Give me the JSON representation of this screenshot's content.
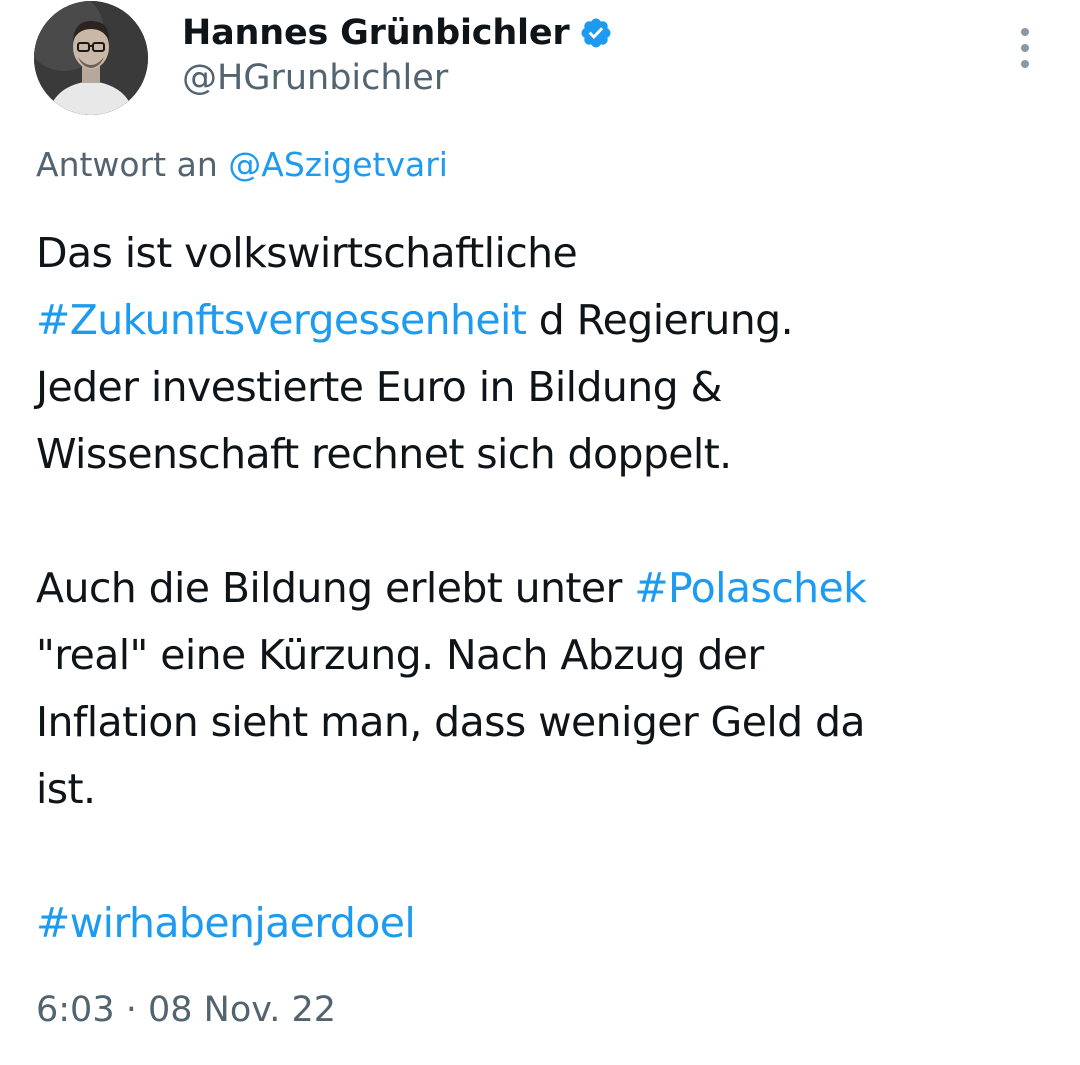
{
  "author": {
    "display_name": "Hannes Grünbichler",
    "handle": "@HGrunbichler",
    "verified_icon": "verified-badge-icon"
  },
  "reply": {
    "prefix": "Antwort an",
    "mention": "@ASzigetvari"
  },
  "tweet": {
    "line1": "Das ist volkswirtschaftliche",
    "line2_hashtag": "#Zukunftsvergessenheit",
    "line2_rest": " d Regierung.",
    "line3": "Jeder investierte Euro in Bildung &",
    "line4": "Wissenschaft rechnet sich doppelt.",
    "line6_text": "Auch die Bildung erlebt unter ",
    "line6_hashtag": "#Polaschek",
    "line7": "\"real\" eine Kürzung. Nach Abzug der",
    "line8": "Inflation sieht man, dass weniger Geld da",
    "line9": "ist.",
    "line11_hashtag": "#wirhabenjaerdoel"
  },
  "meta": {
    "timestamp": "6:03 · 08 Nov. 22"
  },
  "colors": {
    "link": "#1d9bf0",
    "secondary_text": "#536471",
    "primary_text": "#0f1419"
  }
}
